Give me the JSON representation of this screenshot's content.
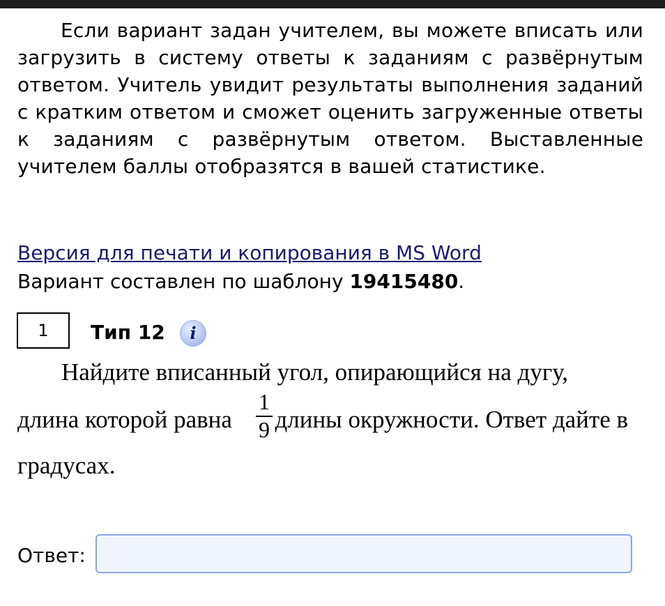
{
  "intro": {
    "text": "Если вариант задан учителем, вы можете вписать или загрузить в систему ответы к заданиям с развёрнутым ответом. Учитель увидит результаты выполнения заданий с кратким ответом и сможет оценить загруженные ответы к заданиям с развёрнутым ответом. Выставленные учителем баллы отобразятся в вашей статистике."
  },
  "print_link": "Версия для печати и копирования в MS Word",
  "variant": {
    "prefix": "Вариант составлен по шаблону ",
    "template_id": "19415480",
    "suffix": "."
  },
  "task": {
    "number": "1",
    "type_label": "Тип 12",
    "info_icon_glyph": "i",
    "problem": {
      "line1": "Найдите вписанный угол, опирающийся на дугу,",
      "line2_before": "длина которой равна",
      "fraction_numerator": "1",
      "fraction_denominator": "9",
      "line2_after": "длины окружности. Ответ дайте в",
      "line3": "градусах."
    }
  },
  "answer": {
    "label": "Ответ:",
    "value": "",
    "placeholder": ""
  },
  "colors": {
    "top_bar": "#1e1e1e",
    "link": "#1a1a6e",
    "input_border": "#8aa6e6",
    "input_bg": "#f1f5fd",
    "info_icon": "#b8c9f0"
  },
  "icons": {
    "info": "info-icon"
  }
}
